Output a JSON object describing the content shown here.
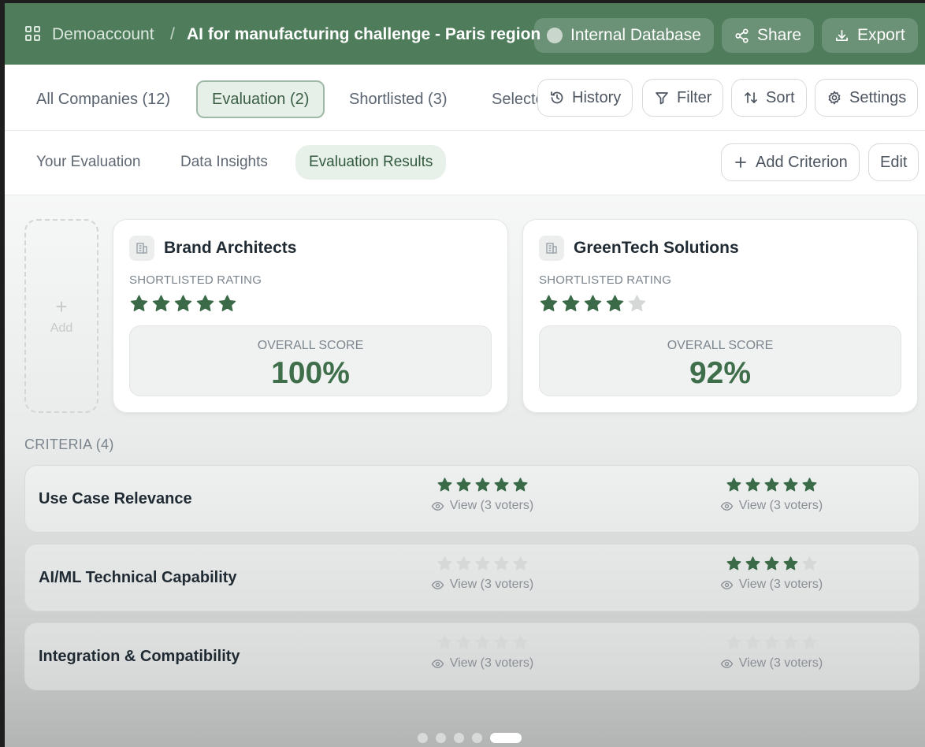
{
  "header": {
    "workspace": "Demoaccount",
    "separator": "/",
    "title": "AI for manufacturing challenge - Paris region",
    "database": "Internal Database",
    "share": "Share",
    "export": "Export"
  },
  "tabs": {
    "all": "All Companies (12)",
    "evaluation": "Evaluation (2)",
    "shortlisted": "Shortlisted (3)",
    "selected_partial": "Selecte",
    "history": "History",
    "filter": "Filter",
    "sort": "Sort",
    "settings": "Settings"
  },
  "subtabs": {
    "your": "Your Evaluation",
    "insights": "Data Insights",
    "results": "Evaluation Results",
    "add_criterion": "Add Criterion",
    "edit": "Edit"
  },
  "add_card": {
    "plus": "+",
    "label": "Add"
  },
  "companies": [
    {
      "name": "Brand Architects",
      "rating_label": "SHORTLISTED RATING",
      "rating": 5,
      "score_label": "OVERALL SCORE",
      "score": "100%"
    },
    {
      "name": "GreenTech Solutions",
      "rating_label": "SHORTLISTED RATING",
      "rating": 4,
      "score_label": "OVERALL SCORE",
      "score": "92%"
    }
  ],
  "criteria_title": "CRITERIA (4)",
  "criteria": [
    {
      "name": "Use Case Relevance",
      "ratings": [
        5,
        5
      ],
      "voters": [
        "View (3 voters)",
        "View (3 voters)"
      ]
    },
    {
      "name": "AI/ML Technical Capability",
      "ratings": [
        0,
        4
      ],
      "voters": [
        "View (3 voters)",
        "View (3 voters)"
      ]
    },
    {
      "name": "Integration & Compatibility",
      "ratings": [
        0,
        0
      ],
      "voters": [
        "View (3 voters)",
        "View (3 voters)"
      ]
    }
  ],
  "pager": {
    "pages": 5,
    "current": 5
  },
  "colors": {
    "header_bg": "#4f7d5c",
    "star_filled": "#3a6a47",
    "star_empty": "#d5d8d6",
    "score": "#3f6e4b"
  }
}
